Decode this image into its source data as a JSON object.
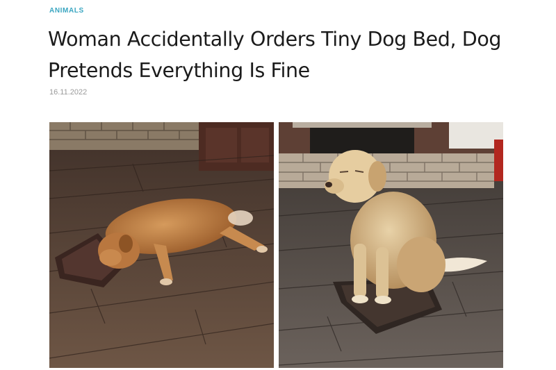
{
  "article": {
    "category": "ANIMALS",
    "title": "Woman Accidentally Orders Tiny Dog Bed, Dog Pretends Everything Is Fine",
    "date": "16.11.2022"
  },
  "colors": {
    "category": "#3aa6c1",
    "title": "#1b1b1b",
    "date": "#9a9a9a"
  },
  "photos": [
    {
      "subject": "golden-retriever-lying-on-tiny-bed"
    },
    {
      "subject": "golden-retriever-sitting-on-tiny-bed"
    }
  ]
}
